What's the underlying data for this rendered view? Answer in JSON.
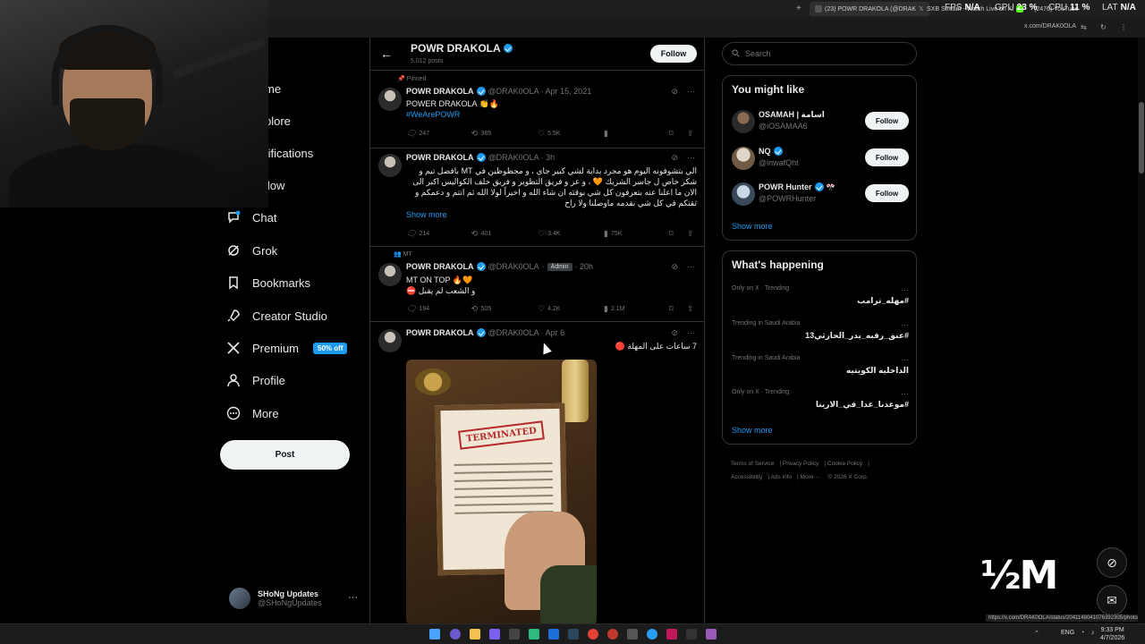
{
  "browser": {
    "tabs": [
      {
        "label": "(23) POWR DRAKOLA (@DRAK",
        "active": true,
        "color": "#1d1d1d"
      },
      {
        "label": "SXB Stream - Watch Live on Ki",
        "active": false,
        "color": "#53fc18"
      },
      {
        "label": "(2476) YouTube",
        "active": false,
        "color": "#ff0000"
      }
    ],
    "new_tab_label": "+",
    "url": "x.com/DRAK0OLA",
    "hud": {
      "fps_label": "FPS",
      "fps_value": "N/A",
      "gpu_label": "GPU",
      "gpu_value": "23 %",
      "cpu_label": "CPU",
      "cpu_value": "11 %",
      "lat_label": "LAT",
      "lat_value": "N/A"
    }
  },
  "nav": {
    "items": [
      {
        "id": "home",
        "label": "me",
        "icon": "home-icon"
      },
      {
        "id": "explore",
        "label": "plore",
        "icon": "search-icon"
      },
      {
        "id": "notifications",
        "label": "tifications",
        "icon": "bell-icon"
      },
      {
        "id": "follow",
        "label": "llow",
        "icon": "person-add-icon"
      },
      {
        "id": "chat",
        "label": "Chat",
        "icon": "chat-icon"
      },
      {
        "id": "grok",
        "label": "Grok",
        "icon": "grok-icon"
      },
      {
        "id": "bookmarks",
        "label": "Bookmarks",
        "icon": "bookmark-icon"
      },
      {
        "id": "creator",
        "label": "Creator Studio",
        "icon": "rocket-icon"
      },
      {
        "id": "premium",
        "label": "Premium",
        "icon": "x-logo-icon"
      },
      {
        "id": "profile",
        "label": "Profile",
        "icon": "person-icon"
      },
      {
        "id": "more",
        "label": "More",
        "icon": "more-circle-icon"
      }
    ],
    "premium_badge": "50% off",
    "post_label": "Post",
    "account": {
      "name": "SHoNg Updates",
      "handle": "@SHoNgUpdates",
      "more": "···"
    }
  },
  "profile_header": {
    "back": "←",
    "name": "POWR DRAKOLA",
    "posts": "5,012 posts",
    "follow_label": "Follow"
  },
  "tweets": [
    {
      "social": "Pinned",
      "name": "POWR DRAKOLA",
      "handle": "@DRAK0OLA · Apr 15, 2021",
      "text": "POWER DRAKOLA 👏🔥",
      "hashtag": "#WeArePOWR",
      "replies": "247",
      "reposts": "385",
      "likes": "5.5K",
      "views": ""
    },
    {
      "name": "POWR DRAKOLA",
      "handle": "@DRAK0OLA · 3h",
      "text": "الي بتشوفونه اليوم هو مجرد بداية لشي كبير جاي ، و محظوظين في MT بافضل تيم و شكر خاص ل جاسر الشريك 🧡 ، و عز و فريق التطوير و فريق خلف الكواليس اكبر الى الان ما اعلنا عنه بتعرفون كل شي بوقته ان شاء الله و اخيراً لولا الله ثم انتم و دعمكم و ثقتكم في كل شي نقدمه ماوصلنا ولا راح",
      "show_more": "Show more",
      "replies": "214",
      "reposts": "401",
      "likes": "3.4K",
      "views": "75K"
    },
    {
      "social": "MT",
      "name": "POWR DRAKOLA",
      "handle": "@DRAK0OLA",
      "badge": "Admin",
      "time": "· 20h",
      "text": "MT ON TOP 🔥🧡",
      "text2": "و الشعب لم يقبل ⛔",
      "replies": "194",
      "reposts": "505",
      "likes": "4.2K",
      "views": "2.1M"
    },
    {
      "name": "POWR DRAKOLA",
      "handle": "@DRAK0OLA · Apr 6",
      "text": "7 ساعات على المهلة 🔴",
      "image_stamp": "TERMINATED"
    }
  ],
  "search": {
    "placeholder": "Search"
  },
  "suggestions": {
    "title": "You might like",
    "items": [
      {
        "name": "OSAMAH | اسامة",
        "handle": "@iOSAMAA6",
        "follow": "Follow"
      },
      {
        "name": "NQ",
        "handle": "@inwafQht",
        "follow": "Follow"
      },
      {
        "name": "POWR Hunter",
        "handle": "@POWRHunter",
        "follow": "Follow"
      }
    ],
    "show_more": "Show more"
  },
  "trends": {
    "title": "What's happening",
    "items": [
      {
        "category": "Only on X · Trending",
        "tag": "#مهله_ترامب"
      },
      {
        "category": "Trending in Saudi Arabia",
        "tag": "#عنق_رقبه_بدر_الحارثي13"
      },
      {
        "category": "Trending in Saudi Arabia",
        "tag": "الداخليه الكويتيه"
      },
      {
        "category": "Only on X · Trending",
        "tag": "#موعدنا_غدا_في_الارينا"
      }
    ],
    "show_more": "Show more"
  },
  "footer": {
    "links": [
      "Terms of Service",
      "Privacy Policy",
      "Cookie Policy",
      "Accessibility",
      "Ads info",
      "More ···",
      "© 2026 X Corp."
    ]
  },
  "overlay": {
    "big_text": "½M",
    "status_url": "https://x.com/DRAK0OLA/status/2041148041076392305/photo/1"
  },
  "taskbar": {
    "lang": "ENG",
    "time": "9:33 PM",
    "date": "4/7/2026"
  }
}
